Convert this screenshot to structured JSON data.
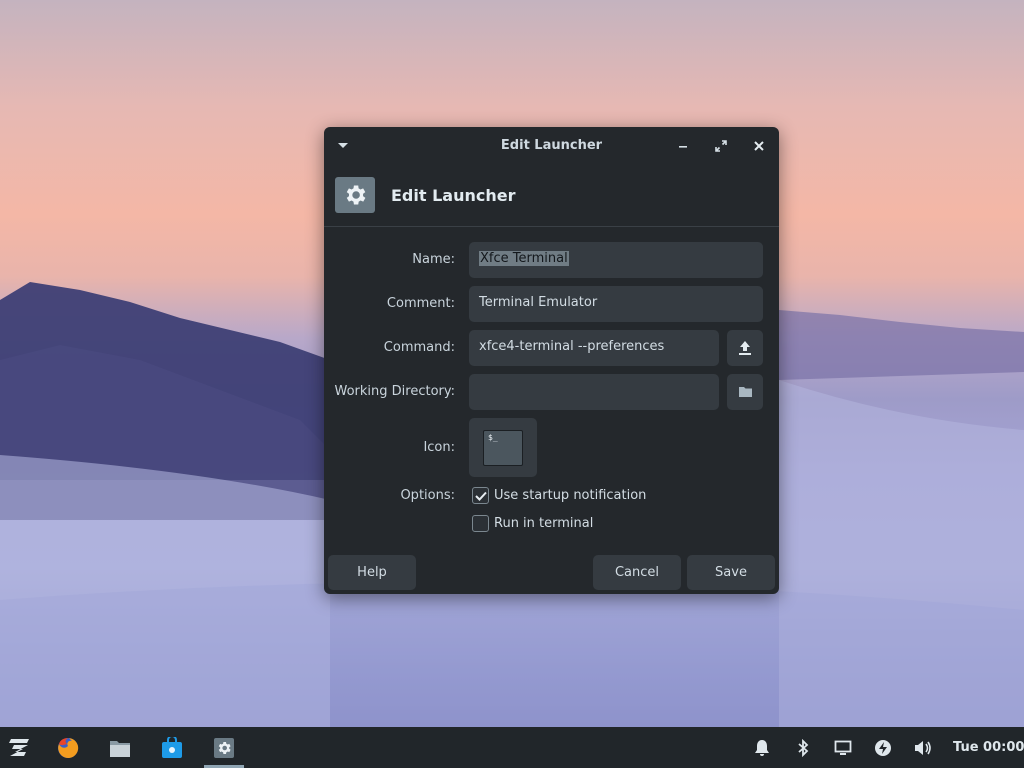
{
  "window": {
    "title": "Edit Launcher",
    "heading": "Edit Launcher"
  },
  "form": {
    "name_label": "Name:",
    "name_value": "Xfce Terminal",
    "comment_label": "Comment:",
    "comment_value": "Terminal Emulator",
    "command_label": "Command:",
    "command_value": "xfce4-terminal --preferences",
    "workdir_label": "Working Directory:",
    "workdir_value": "",
    "icon_label": "Icon:",
    "icon_preview_text": "$_",
    "options_label": "Options:",
    "options": [
      {
        "label": "Use startup notification",
        "checked": true
      },
      {
        "label": "Run in terminal",
        "checked": false
      }
    ]
  },
  "buttons": {
    "help": "Help",
    "cancel": "Cancel",
    "save": "Save"
  },
  "taskbar": {
    "apps": [
      "zorin-menu-icon",
      "firefox-icon",
      "files-icon",
      "software-store-icon",
      "settings-icon"
    ],
    "active_app": "settings-icon",
    "tray": [
      "notification-bell-icon",
      "bluetooth-icon",
      "display-icon",
      "power-icon",
      "volume-icon"
    ],
    "clock": "Tue 00:00"
  },
  "colors": {
    "dialog_bg": "#24282c",
    "field_bg": "#353b41",
    "taskbar_bg": "#21262a",
    "selection_bg": "#707c84"
  }
}
